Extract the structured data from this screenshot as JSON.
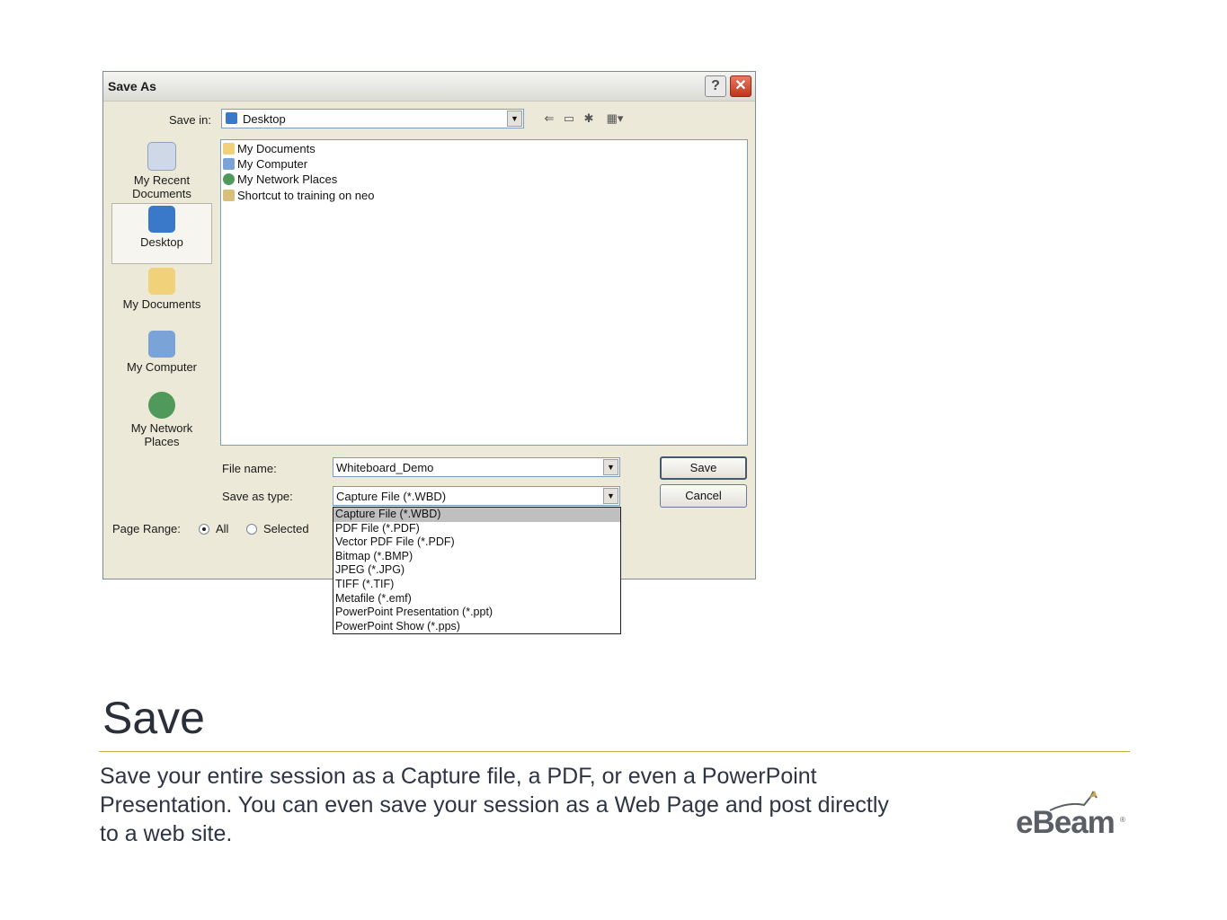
{
  "dialog": {
    "title": "Save As",
    "help_glyph": "?",
    "close_glyph": "✕",
    "save_in_label": "Save in:",
    "save_in_value": "Desktop",
    "places": [
      {
        "label": "My Recent Documents"
      },
      {
        "label": "Desktop"
      },
      {
        "label": "My Documents"
      },
      {
        "label": "My Computer"
      },
      {
        "label": "My Network Places"
      }
    ],
    "files": [
      {
        "label": "My Documents"
      },
      {
        "label": "My Computer"
      },
      {
        "label": "My Network Places"
      },
      {
        "label": "Shortcut to training on neo"
      }
    ],
    "file_name_label": "File name:",
    "file_name_value": "Whiteboard_Demo",
    "save_type_label": "Save as type:",
    "save_type_value": "Capture File (*.WBD)",
    "save_button": "Save",
    "cancel_button": "Cancel",
    "page_range_label": "Page Range:",
    "range_all": "All",
    "range_selected": "Selected",
    "type_options": [
      "Capture File (*.WBD)",
      "PDF File (*.PDF)",
      "Vector PDF File (*.PDF)",
      "Bitmap (*.BMP)",
      "JPEG (*.JPG)",
      "TIFF (*.TIF)",
      "Metafile (*.emf)",
      "PowerPoint Presentation (*.ppt)",
      "PowerPoint Show (*.pps)"
    ]
  },
  "slide": {
    "title": "Save",
    "body": "Save your entire session as a Capture file, a PDF, or even a PowerPoint Presentation. You can even save your session as a Web Page and post directly to a web site."
  },
  "logo": {
    "text": "eBeam",
    "reg": "®"
  },
  "icons": [
    "back-arrow-icon",
    "up-folder-icon",
    "new-folder-icon",
    "view-menu-icon",
    "dropdown-arrow-icon"
  ]
}
